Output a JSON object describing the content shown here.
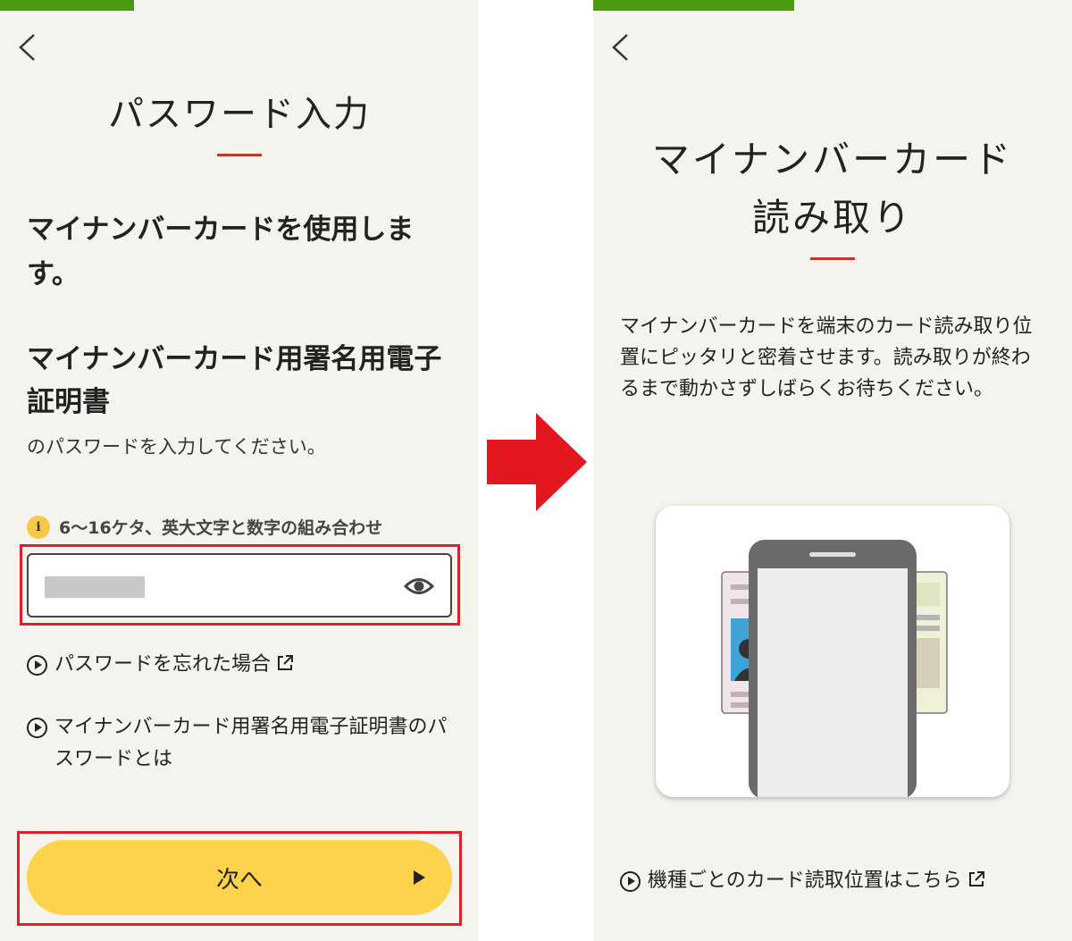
{
  "left_screen": {
    "title": "パスワード入力",
    "lead": "マイナンバーカードを使用します。",
    "cert_name": "マイナンバーカード用署名用電子証明書",
    "instruction": "のパスワードを入力してください。",
    "hint": "6〜16ケタ、英大文字と数字の組み合わせ",
    "info_icon_glyph": "i",
    "password_value": "",
    "links": [
      {
        "label": "パスワードを忘れた場合"
      },
      {
        "label": "マイナンバーカード用署名用電子証明書のパスワードとは"
      }
    ],
    "next_button": "次へ",
    "progress_fraction": 0.28
  },
  "right_screen": {
    "title_line1": "マイナンバーカード",
    "title_line2": "読み取り",
    "description": "マイナンバーカードを端末のカード読み取り位置にピッタリと密着させます。読み取りが終わるまで動かさずしばらくお待ちください。",
    "link": "機種ごとのカード読取位置はこちら",
    "progress_fraction": 0.42
  },
  "colors": {
    "background": "#f5f3ed",
    "progress": "#4b9a12",
    "accent_rule": "#c0392b",
    "highlight": "#d9212a",
    "button": "#fdd34b",
    "arrow": "#e3171f"
  },
  "icons": [
    "chevron-left-icon",
    "info-icon",
    "eye-icon",
    "play-circle-icon",
    "external-link-icon",
    "right-arrow-icon",
    "phone-card-illustration"
  ]
}
